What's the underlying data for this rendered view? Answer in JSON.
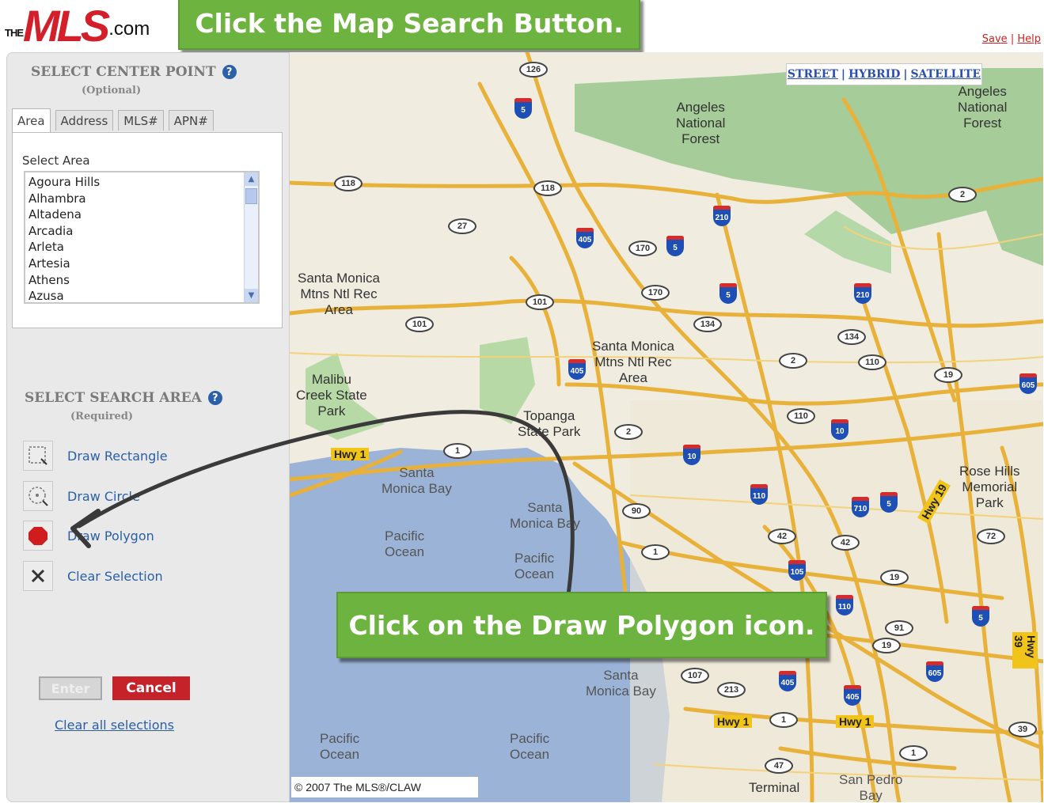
{
  "header": {
    "logo": {
      "the": "THE",
      "mls": "MLS",
      "com": ".com"
    },
    "links": {
      "save": "Save",
      "separator": "|",
      "help": "Help"
    }
  },
  "annotations": {
    "top_banner": "Click the Map Search Button.",
    "bottom_banner": "Click on the Draw Polygon icon."
  },
  "center_point": {
    "title": "SELECT CENTER POINT",
    "subtitle": "(Optional)",
    "tabs": [
      "Area",
      "Address",
      "MLS#",
      "APN#"
    ],
    "active_tab": "Area",
    "select_label": "Select Area",
    "areas": [
      "Agoura Hills",
      "Alhambra",
      "Altadena",
      "Arcadia",
      "Arleta",
      "Artesia",
      "Athens",
      "Azusa"
    ]
  },
  "search_area": {
    "title": "SELECT SEARCH AREA",
    "subtitle": "(Required)",
    "tools": [
      {
        "label": "Draw Rectangle",
        "icon": "rectangle-icon"
      },
      {
        "label": "Draw Circle",
        "icon": "circle-icon"
      },
      {
        "label": "Draw Polygon",
        "icon": "polygon-icon"
      },
      {
        "label": "Clear Selection",
        "icon": "clear-icon"
      }
    ]
  },
  "buttons": {
    "enter": "Enter",
    "cancel": "Cancel",
    "clear_all": "Clear all selections"
  },
  "map": {
    "type_links": [
      "STREET",
      "HYBRID",
      "SATELLITE"
    ],
    "copyright": "© 2007 The MLS®/CLAW",
    "labels": {
      "forest1": "Angeles\nNational\nForest",
      "forest2": "Angeles\nNational\nForest",
      "smm1": "Santa Monica\nMtns Ntl Rec\nArea",
      "smm2": "Santa Monica\nMtns Ntl Rec\nArea",
      "malibu": "Malibu\nCreek State\nPark",
      "topanga": "Topanga\nState Park",
      "smbay1": "Santa\nMonica Bay",
      "smbay2": "Santa\nMonica Bay",
      "smbay3": "Santa\nMonica Bay",
      "pac1": "Pacific\nOcean",
      "pac2": "Pacific\nOcean",
      "pac3": "Pacific\nOcean",
      "pac4": "Pacific\nOcean",
      "rosehills": "Rose Hills\nMemorial\nPark",
      "terminal": "Terminal",
      "sanpedro": "San Pedro\nBay"
    },
    "highways": {
      "hwy1a": "Hwy 1",
      "hwy1b": "Hwy 1",
      "hwy1c": "Hwy 1",
      "hwy19": "Hwy 19",
      "hwy39": "Hwy 39"
    },
    "shields": [
      "5",
      "210",
      "405",
      "5",
      "5",
      "210",
      "405",
      "10",
      "110",
      "10",
      "710",
      "5",
      "105",
      "110",
      "405",
      "405",
      "605",
      "605",
      "5"
    ],
    "ovals": [
      "126",
      "118",
      "118",
      "27",
      "170",
      "170",
      "101",
      "101",
      "134",
      "134",
      "2",
      "110",
      "19",
      "110",
      "2",
      "1",
      "90",
      "1",
      "42",
      "42",
      "72",
      "19",
      "91",
      "19",
      "107",
      "213",
      "1",
      "1",
      "39",
      "47",
      "2"
    ]
  }
}
